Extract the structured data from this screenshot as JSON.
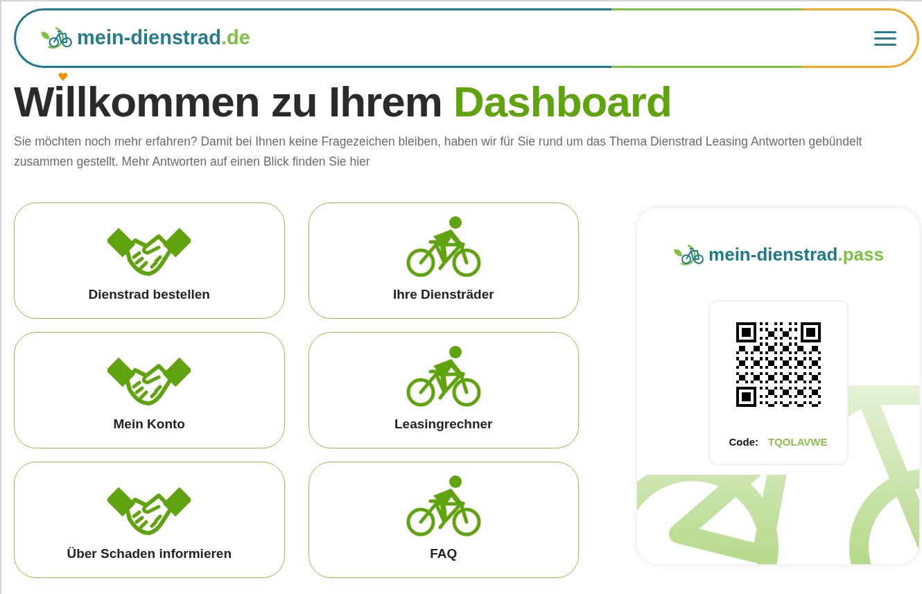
{
  "header": {
    "logo_name": "mein-dienstrad",
    "logo_suffix": ".de"
  },
  "heading": {
    "text": "Willkommen zu Ihrem",
    "highlight": "Dashboard"
  },
  "intro": "Sie möchten noch mehr erfahren? Damit bei Ihnen keine Fragezeichen bleiben, haben wir für Sie rund um das Thema Dienstrad Leasing Antworten gebündelt zusammen gestellt. Mehr Antworten auf einen Blick finden Sie hier",
  "tiles": [
    {
      "label": "Dienstrad bestellen",
      "kind": "handshake"
    },
    {
      "label": "Ihre Diensträder",
      "kind": "cyclist"
    },
    {
      "label": "Mein Konto",
      "kind": "handshake"
    },
    {
      "label": "Leasingrechner",
      "kind": "cyclist"
    },
    {
      "label": "Über Schaden informieren",
      "kind": "handshake"
    },
    {
      "label": "FAQ",
      "kind": "cyclist"
    }
  ],
  "pass": {
    "logo_name": "mein-dienstrad",
    "logo_suffix": ".pass",
    "code_label": "Code:",
    "code": "TQOLAVWE"
  }
}
